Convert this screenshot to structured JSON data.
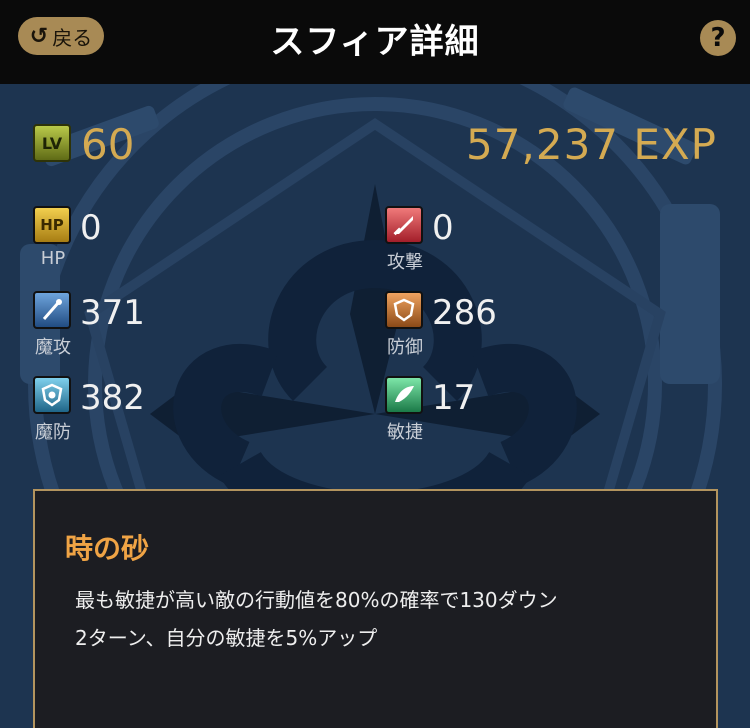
{
  "header": {
    "back_label": "戻る",
    "title": "スフィア詳細",
    "help_icon": "question-icon"
  },
  "level": {
    "badge": "LV",
    "value": "60",
    "exp": "57,237 EXP"
  },
  "stats": [
    {
      "key": "hp",
      "badge": "HP",
      "label": "HP",
      "value": "0",
      "color": "#c9a227",
      "icon": "hp-icon"
    },
    {
      "key": "attack",
      "badge": "",
      "label": "攻撃",
      "value": "0",
      "color": "#c2363f",
      "icon": "sword-icon"
    },
    {
      "key": "magic-attack",
      "badge": "",
      "label": "魔攻",
      "value": "371",
      "color": "#3a6fa7",
      "icon": "staff-icon"
    },
    {
      "key": "defense",
      "badge": "",
      "label": "防御",
      "value": "286",
      "color": "#b76a2c",
      "icon": "shield-icon"
    },
    {
      "key": "magic-defense",
      "badge": "",
      "label": "魔防",
      "value": "382",
      "color": "#3b8db0",
      "icon": "magic-shield-icon"
    },
    {
      "key": "agility",
      "badge": "",
      "label": "敏捷",
      "value": "17",
      "color": "#2f9a62",
      "icon": "wing-icon"
    }
  ],
  "skill": {
    "name": "時の砂",
    "description_line1": "最も敏捷が高い敵の行動値を80%の確率で130ダウン",
    "description_line2": "2ターン、自分の敏捷を5%アップ"
  },
  "colors": {
    "accent": "#d4aa52",
    "panel_border": "#b3945e",
    "skill_name": "#f0a445"
  }
}
